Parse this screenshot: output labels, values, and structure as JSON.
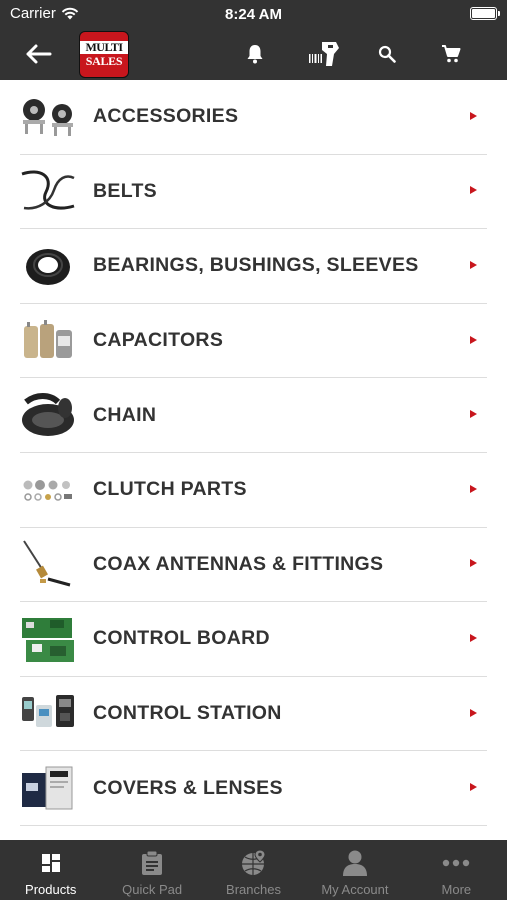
{
  "status_bar": {
    "carrier": "Carrier",
    "time": "8:24 AM",
    "battery_level": 1.0
  },
  "header": {
    "back_icon": "arrow-left-icon",
    "logo": {
      "line1": "MULTI",
      "line2": "SALES",
      "brand_color": "#c8161d"
    },
    "actions": [
      {
        "icon": "bell-icon"
      },
      {
        "icon": "barcode-scanner-icon"
      },
      {
        "icon": "search-icon"
      },
      {
        "icon": "cart-icon"
      }
    ]
  },
  "categories": [
    {
      "label": "ACCESSORIES",
      "thumb": "accessories-thumb"
    },
    {
      "label": "BELTS",
      "thumb": "belts-thumb"
    },
    {
      "label": "BEARINGS, BUSHINGS, SLEEVES",
      "thumb": "bearings-thumb"
    },
    {
      "label": "CAPACITORS",
      "thumb": "capacitors-thumb"
    },
    {
      "label": "CHAIN",
      "thumb": "chain-thumb"
    },
    {
      "label": "CLUTCH PARTS",
      "thumb": "clutch-parts-thumb"
    },
    {
      "label": "COAX ANTENNAS & FITTINGS",
      "thumb": "coax-thumb"
    },
    {
      "label": "CONTROL BOARD",
      "thumb": "control-board-thumb"
    },
    {
      "label": "CONTROL STATION",
      "thumb": "control-station-thumb"
    },
    {
      "label": "COVERS & LENSES",
      "thumb": "covers-lenses-thumb"
    }
  ],
  "tab_bar": {
    "tabs": [
      {
        "label": "Products",
        "icon": "grid-icon",
        "active": true
      },
      {
        "label": "Quick Pad",
        "icon": "clipboard-icon",
        "active": false
      },
      {
        "label": "Branches",
        "icon": "globe-pin-icon",
        "active": false
      },
      {
        "label": "My Account",
        "icon": "user-icon",
        "active": false
      },
      {
        "label": "More",
        "icon": "more-dots-icon",
        "active": false
      }
    ]
  },
  "colors": {
    "bar_background": "#333333",
    "accent": "#c8161d",
    "tab_inactive": "#8a8a8a",
    "label_text": "#333333"
  }
}
